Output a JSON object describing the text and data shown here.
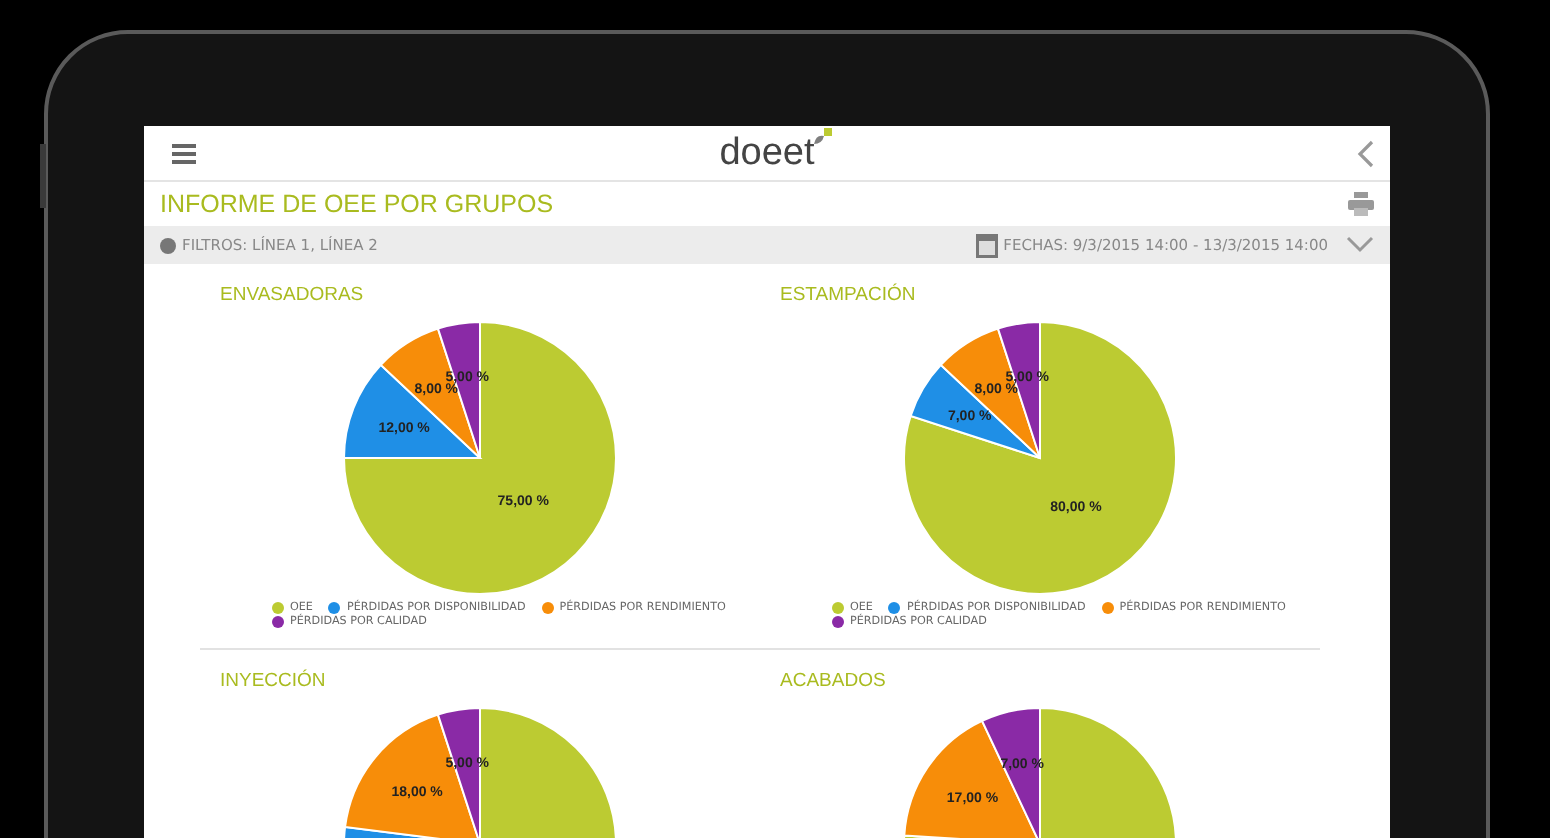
{
  "header": {
    "logo": "doeet"
  },
  "report": {
    "title": "INFORME DE OEE POR GRUPOS"
  },
  "filter_bar": {
    "filters": "FILTROS: LÍNEA 1, LÍNEA 2",
    "dates": "FECHAS: 9/3/2015 14:00 - 13/3/2015 14:00",
    "expanded": false
  },
  "panels": [
    {
      "chart_data": {
        "type": "pie",
        "title": "ENVASADORAS",
        "categories": [
          "OEE",
          "PÉRDIDAS POR DISPONIBILIDAD",
          "PÉRDIDAS POR RENDIMIENTO",
          "PÉRDIDAS POR CALIDAD"
        ],
        "values": [
          75,
          12,
          8,
          5
        ],
        "colors": [
          "#bccb32",
          "#1f8fe6",
          "#f78d09",
          "#8a2aa6"
        ],
        "value_labels": [
          "75,00 %",
          "12,00 %",
          "8,00 %",
          "5,00 %"
        ]
      }
    },
    {
      "chart_data": {
        "type": "pie",
        "title": "ESTAMPACIÓN",
        "categories": [
          "OEE",
          "PÉRDIDAS POR DISPONIBILIDAD",
          "PÉRDIDAS POR RENDIMIENTO",
          "PÉRDIDAS POR CALIDAD"
        ],
        "values": [
          80,
          7,
          8,
          5
        ],
        "colors": [
          "#bccb32",
          "#1f8fe6",
          "#f78d09",
          "#8a2aa6"
        ],
        "value_labels": [
          "80,00 %",
          "7,00 %",
          "8,00 %",
          "5,00 %"
        ]
      }
    },
    {
      "chart_data": {
        "type": "pie",
        "title": "INYECCIÓN",
        "values": [
          75,
          2,
          18,
          5
        ],
        "colors": [
          "#bccb32",
          "#1f8fe6",
          "#f78d09",
          "#8a2aa6"
        ],
        "value_labels": [
          null,
          null,
          "18,00 %",
          "5,00 %"
        ]
      }
    },
    {
      "chart_data": {
        "type": "pie",
        "title": "ACABADOS",
        "values": [
          76,
          null,
          17,
          7
        ],
        "colors": [
          "#bccb32",
          "#1f8fe6",
          "#f78d09",
          "#8a2aa6"
        ],
        "value_labels": [
          null,
          null,
          "17,00 %",
          "7,00 %"
        ]
      }
    }
  ]
}
